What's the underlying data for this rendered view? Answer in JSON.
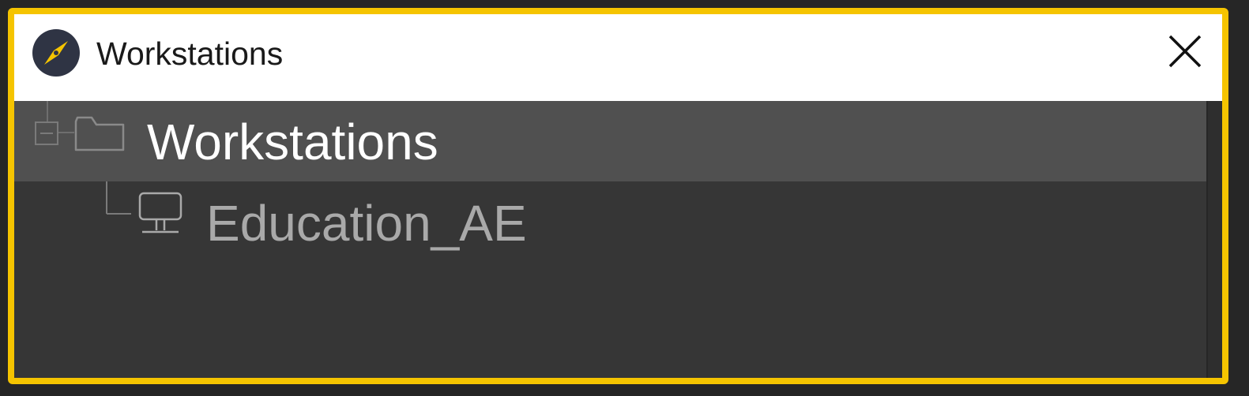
{
  "window": {
    "title": "Workstations",
    "title_icon": "compass-icon",
    "close_icon": "close-icon",
    "frame_color": "#f5c400"
  },
  "tree": {
    "root": {
      "label": "Workstations",
      "icon": "folder-icon",
      "expander_icon": "collapse-minus-icon",
      "selected": true
    },
    "children": [
      {
        "label": "Education_AE",
        "icon": "computer-monitor-icon"
      }
    ]
  },
  "colors": {
    "background": "#363636",
    "selected_row": "#505050",
    "root_text": "#ffffff",
    "child_text": "#a9a9a9"
  }
}
